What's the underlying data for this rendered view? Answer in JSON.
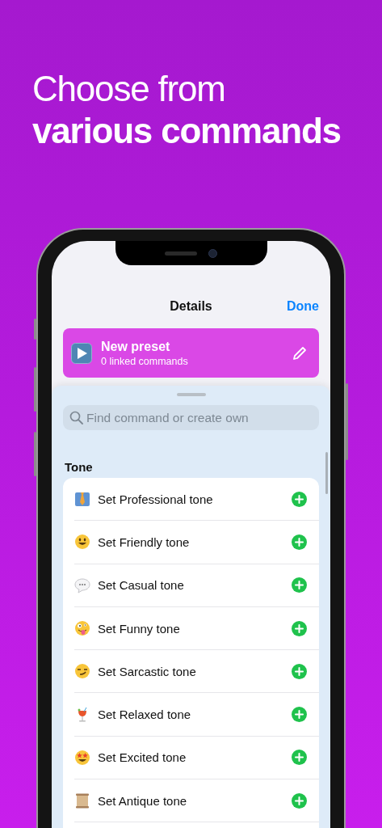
{
  "headline": {
    "line_1": "Choose from",
    "line_2": "various commands"
  },
  "nav": {
    "title": "Details",
    "done": "Done"
  },
  "preset": {
    "title": "New preset",
    "subtitle": "0 linked commands"
  },
  "search": {
    "placeholder": "Find command or create own"
  },
  "section": {
    "title": "Tone",
    "items": [
      {
        "label": "Set Professional tone"
      },
      {
        "label": "Set Friendly tone"
      },
      {
        "label": "Set Casual tone"
      },
      {
        "label": "Set Funny tone"
      },
      {
        "label": "Set Sarcastic tone"
      },
      {
        "label": "Set Relaxed tone"
      },
      {
        "label": "Set Excited tone"
      },
      {
        "label": "Set Antique tone"
      }
    ]
  }
}
